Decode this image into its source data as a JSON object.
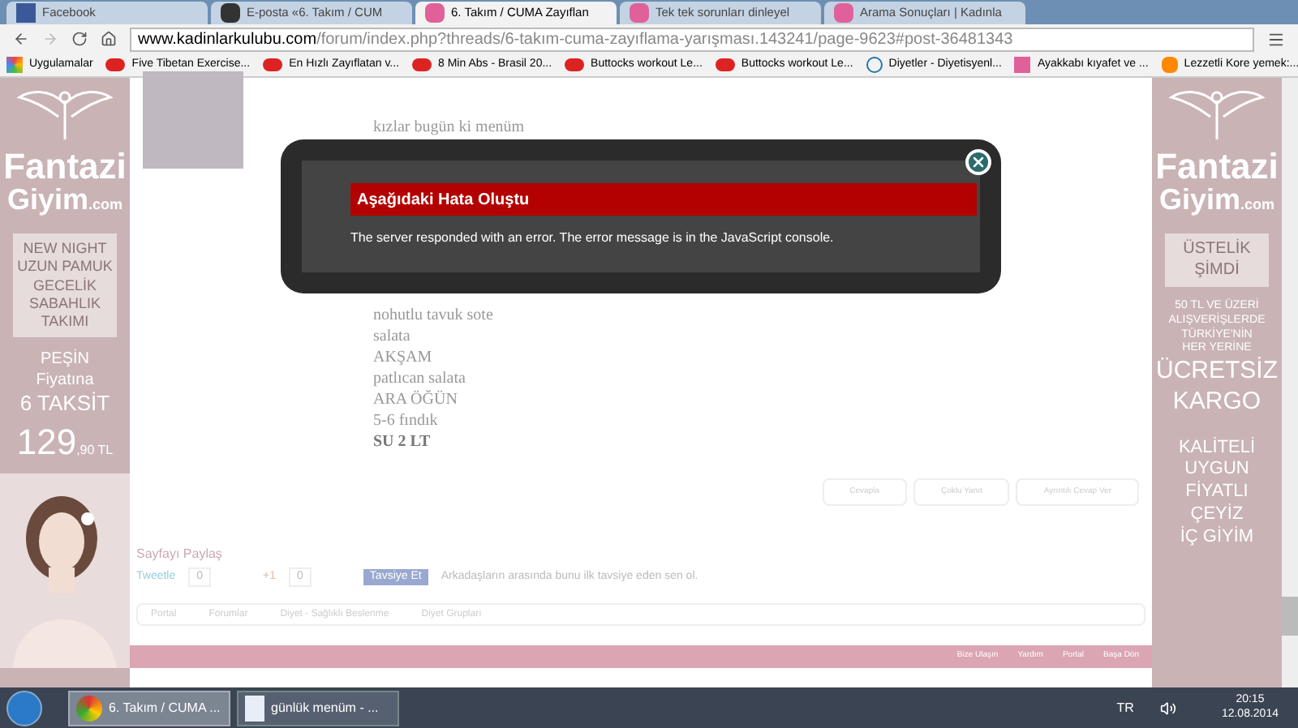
{
  "browser": {
    "tabs": [
      {
        "title": "Facebook",
        "selected": false,
        "kind": "fb"
      },
      {
        "title": "E-posta «6. Takım / CUM",
        "selected": false,
        "kind": "mail"
      },
      {
        "title": "6. Takım / CUMA Zayıflan",
        "selected": true,
        "kind": "pink"
      },
      {
        "title": "Tek tek sorunları dinleyel",
        "selected": false,
        "kind": "pink"
      },
      {
        "title": "Arama Sonuçları | Kadınla",
        "selected": false,
        "kind": "pink"
      }
    ],
    "url_host": "www.kadinlarkulubu.com",
    "url_path": "/forum/index.php?threads/6-takım-cuma-zayıflama-yarışması.143241/page-9623#post-36481343",
    "bookmarks": [
      {
        "label": "Uygulamalar",
        "kind": "apps"
      },
      {
        "label": "Five Tibetan Exercise...",
        "kind": "video"
      },
      {
        "label": "En Hızlı Zayıflatan v...",
        "kind": "video"
      },
      {
        "label": "8 Min Abs - Brasil 20...",
        "kind": "video"
      },
      {
        "label": "Buttocks workout Le...",
        "kind": "video"
      },
      {
        "label": "Buttocks workout Le...",
        "kind": "video"
      },
      {
        "label": "Diyetler - Diyetisyenl...",
        "kind": "d"
      },
      {
        "label": "Ayakkabı kıyafet ve ...",
        "kind": "pink"
      },
      {
        "label": "Lezzetli Kore yemek:...",
        "kind": "blog"
      }
    ]
  },
  "left_ad": {
    "brand": "Fantazi",
    "brand2": "Giyim",
    "domain": ".com",
    "lines": [
      "NEW NIGHT",
      "UZUN PAMUK",
      "GECELİK",
      "SABAHLIK",
      "TAKIMI"
    ],
    "offer": [
      "PEŞİN",
      "Fiyatına",
      "6 TAKSİT"
    ],
    "price": "129",
    "price_cents": ",90 TL"
  },
  "right_ad": {
    "brand": "Fantazi",
    "brand2": "Giyim",
    "domain": ".com",
    "badge": [
      "ÜSTELİK",
      "ŞİMDİ"
    ],
    "lines": [
      "50 TL VE ÜZERİ",
      "ALIŞVERİŞLERDE",
      "TÜRKİYE'NİN",
      "HER YERİNE"
    ],
    "big": [
      "ÜCRETSİZ",
      "KARGO"
    ],
    "lines2": [
      "KALİTELİ",
      "UYGUN",
      "FİYATLI",
      "ÇEYİZ",
      "İÇ GİYİM"
    ]
  },
  "post": {
    "lines": [
      {
        "text": "kızlar bugün ki menüm",
        "bold": false
      },
      {
        "text": "nohutlu tavuk sote",
        "bold": false
      },
      {
        "text": "salata",
        "bold": false
      },
      {
        "text": "AKŞAM",
        "bold": false
      },
      {
        "text": "patlıcan salata",
        "bold": false
      },
      {
        "text": "ARA ÖĞÜN",
        "bold": false
      },
      {
        "text": "5-6 fındık",
        "bold": false
      },
      {
        "text": "SU 2 LT",
        "bold": true
      }
    ],
    "actions": [
      "Cevapla",
      "Çoklu Yanıt",
      "Ayrıntılı Cevap Ver"
    ]
  },
  "share": {
    "title": "Sayfayı Paylaş",
    "tweet": "Tweetle",
    "tweet_count": "0",
    "plus": "+1",
    "plus_count": "0",
    "recommend": "Tavsiye Et",
    "recommend_text": "Arkadaşların arasında bunu ilk tavsiye eden sen ol."
  },
  "breadcrumbs": [
    "Portal",
    "Forumlar",
    "Diyet - Sağlıklı Beslenme",
    "Diyet Grupları"
  ],
  "footer_links": [
    "Bize Ulaşın",
    "Yardım",
    "Portal",
    "Başa Dön"
  ],
  "dialog": {
    "title": "Aşağıdaki Hata Oluştu",
    "message": "The server responded with an error. The error message is in the JavaScript console."
  },
  "taskbar": {
    "items": [
      {
        "label": "6. Takım / CUMA ...",
        "kind": "chrome",
        "selected": true
      },
      {
        "label": "günlük menüm - ...",
        "kind": "doc",
        "selected": false
      }
    ],
    "lang": "TR",
    "time": "20:15",
    "date": "12.08.2014"
  }
}
